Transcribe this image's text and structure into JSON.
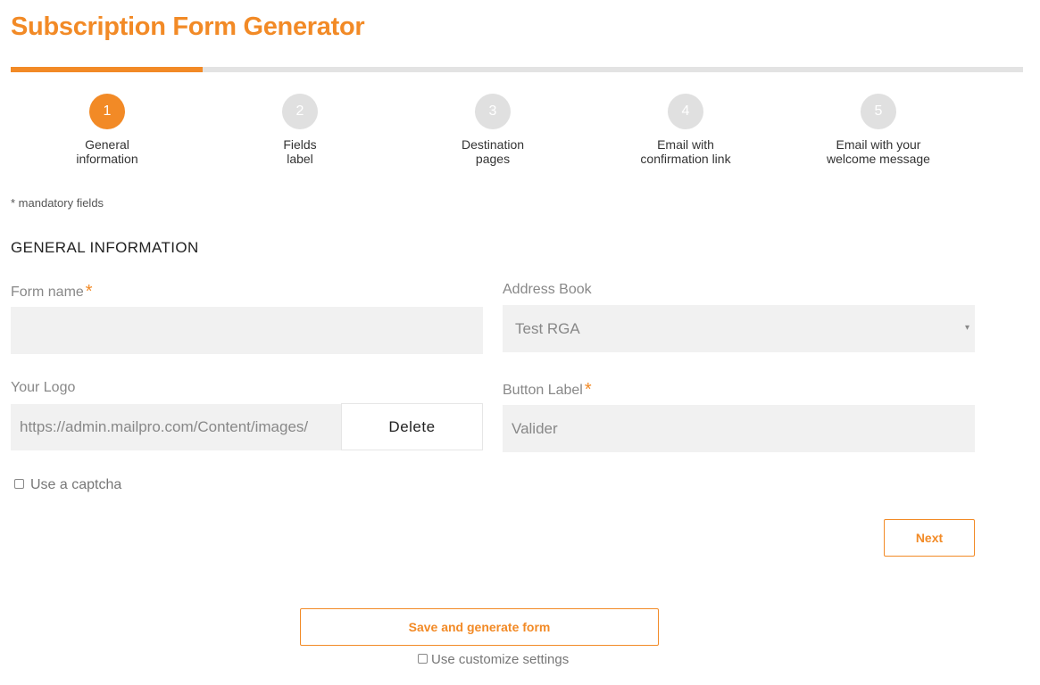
{
  "header": {
    "title": "Subscription Form Generator"
  },
  "progress": {
    "fraction": 0.19,
    "color": "#f28a26"
  },
  "steps": [
    {
      "number": "1",
      "line1": "General",
      "line2": "information",
      "active": true
    },
    {
      "number": "2",
      "line1": "Fields",
      "line2": "label",
      "active": false
    },
    {
      "number": "3",
      "line1": "Destination",
      "line2": "pages",
      "active": false
    },
    {
      "number": "4",
      "line1": "Email with",
      "line2": "confirmation link",
      "active": false
    },
    {
      "number": "5",
      "line1": "Email with your",
      "line2": "welcome message",
      "active": false
    }
  ],
  "mandatory_note": "* mandatory fields",
  "section_title": "GENERAL INFORMATION",
  "form": {
    "form_name": {
      "label": "Form name",
      "required_mark": "*",
      "value": ""
    },
    "address_book": {
      "label": "Address Book",
      "value": "Test RGA",
      "arrow": "▾"
    },
    "logo": {
      "label": "Your Logo",
      "value": "https://admin.mailpro.com/Content/images/",
      "delete_label": "Delete"
    },
    "button_label": {
      "label": "Button Label",
      "required_mark": "*",
      "value": "Valider"
    },
    "captcha": {
      "label": "Use a captcha",
      "checked": false
    }
  },
  "actions": {
    "next_label": "Next",
    "save_label": "Save and generate form",
    "customize_label": "Use customize settings"
  },
  "colors": {
    "accent": "#f28a26",
    "input_bg": "#f1f1f1",
    "step_inactive": "#e0e0e0"
  }
}
